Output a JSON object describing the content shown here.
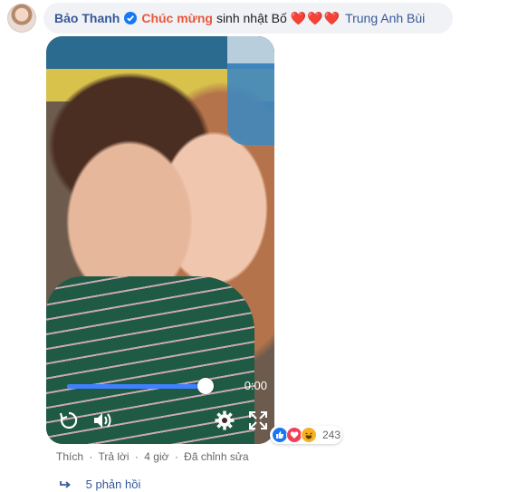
{
  "comment": {
    "author": "Bảo Thanh",
    "highlight": "Chúc mừng",
    "text": "sinh nhật Bố",
    "hearts": "❤️❤️❤️",
    "tag": "Trung Anh Bùi"
  },
  "video": {
    "time": "0:00",
    "progress": 0.98,
    "controls": [
      "replay-icon",
      "volume-icon",
      "settings-icon",
      "fullscreen-icon"
    ]
  },
  "reactions": {
    "types": [
      "like-icon",
      "love-icon",
      "haha-icon"
    ],
    "count": "243"
  },
  "actions": {
    "like": "Thích",
    "reply": "Trả lời",
    "time": "4 giờ",
    "edited": "Đã chỉnh sửa",
    "separator": "·"
  },
  "replies": {
    "label": "5 phản hồi"
  },
  "colors": {
    "link": "#385898",
    "highlight": "#e9573f",
    "bubble": "#f0f2f5",
    "progress": "#4080ff"
  }
}
